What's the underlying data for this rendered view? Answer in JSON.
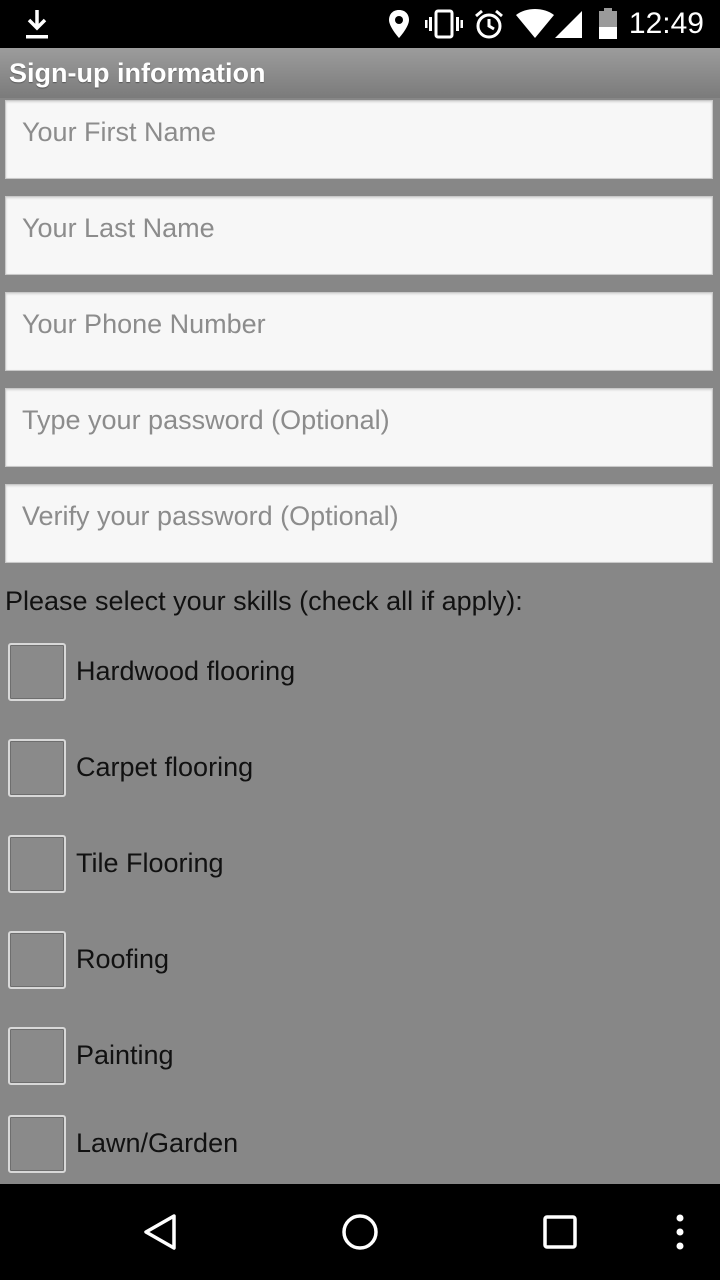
{
  "status_bar": {
    "time": "12:49",
    "icons": [
      "download-icon",
      "location-icon",
      "vibrate-icon",
      "alarm-icon",
      "wifi-icon",
      "signal-icon",
      "battery-icon"
    ]
  },
  "header": {
    "title": "Sign-up information"
  },
  "form": {
    "first_name": {
      "placeholder": "Your First Name",
      "value": ""
    },
    "last_name": {
      "placeholder": "Your Last Name",
      "value": ""
    },
    "phone": {
      "placeholder": "Your Phone Number",
      "value": ""
    },
    "password": {
      "placeholder": "Type your password (Optional)",
      "value": ""
    },
    "verify_password": {
      "placeholder": "Verify your password (Optional)",
      "value": ""
    }
  },
  "skills": {
    "label": "Please select your skills (check all if apply):",
    "items": [
      {
        "label": "Hardwood flooring",
        "checked": false
      },
      {
        "label": "Carpet flooring",
        "checked": false
      },
      {
        "label": "Tile Flooring",
        "checked": false
      },
      {
        "label": "Roofing",
        "checked": false
      },
      {
        "label": "Painting",
        "checked": false
      },
      {
        "label": "Lawn/Garden",
        "checked": false
      }
    ]
  },
  "nav_bar": {
    "buttons": [
      "back-icon",
      "home-icon",
      "recents-icon",
      "overflow-menu-icon"
    ]
  }
}
